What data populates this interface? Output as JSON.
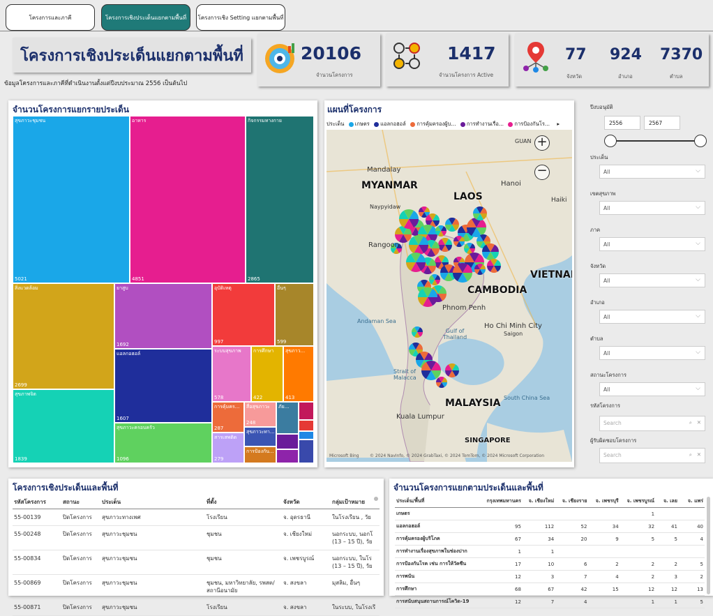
{
  "tabs": [
    {
      "label": "โครงการและภาคี"
    },
    {
      "label": "โครงการเชิงประเด็นแยกตามพื้นที่"
    },
    {
      "label": "โครงการเชิง Setting แยกตามพื้นที่"
    }
  ],
  "header": {
    "title": "โครงการเชิงประเด็นแยกตามพื้นที่",
    "subtitle": "ข้อมูลโครงการและภาคีที่ดำเนินงานตั้งแต่ปีงบประมาณ 2556 เป็นต้นไป"
  },
  "kpi": {
    "projects_value": "20106",
    "projects_label": "จำนวนโครงการ",
    "active_value": "1417",
    "active_label": "จำนวนโครงการ Active",
    "province_value": "77",
    "province_label": "จังหวัด",
    "district_value": "924",
    "district_label": "อำเภอ",
    "subdistrict_value": "7370",
    "subdistrict_label": "ตำบล"
  },
  "treemap": {
    "title": "จำนวนโครงการแยกรายประเด็น",
    "items": [
      {
        "name": "สุขภาวะชุมชน",
        "value": "5021",
        "color": "#1aa7e8"
      },
      {
        "name": "อาหาร",
        "value": "4851",
        "color": "#e61e8f"
      },
      {
        "name": "กิจกรรมทางกาย",
        "value": "2865",
        "color": "#1f7472"
      },
      {
        "name": "สิ่งแวดล้อม",
        "value": "2699",
        "color": "#d2a51a"
      },
      {
        "name": "ยาสูบ",
        "value": "1692",
        "color": "#b14fc1"
      },
      {
        "name": "อุบัติเหตุ",
        "value": "997",
        "color": "#f23b3b"
      },
      {
        "name": "อื่นๆ",
        "value": "599",
        "color": "#a7862a"
      },
      {
        "name": "แอลกอฮอล์",
        "value": "1607",
        "color": "#1f2e9b"
      },
      {
        "name": "ระบบสุขภาพ",
        "value": "578",
        "color": "#e777c9"
      },
      {
        "name": "การศึกษา",
        "value": "422",
        "color": "#e3b400"
      },
      {
        "name": "สุขภาว...",
        "value": "413",
        "color": "#ff7a00"
      },
      {
        "name": "สุขภาพจิต",
        "value": "1839",
        "color": "#15d2b5"
      },
      {
        "name": "สุขภาวะครอบครัว",
        "value": "1096",
        "color": "#5fd15f"
      },
      {
        "name": "การคุ้มคร...",
        "value": "287",
        "color": "#ed6b3a"
      },
      {
        "name": "สื่อสุขภาวะ",
        "value": "248",
        "color": "#f79a9a"
      },
      {
        "name": "สารเสพติด",
        "value": "279",
        "color": "#bda1f7"
      },
      {
        "name": "สุขภาวะทา...",
        "value": "",
        "color": "#3b55b3"
      },
      {
        "name": "การป้องกัน...",
        "value": "",
        "color": "#d47a1f"
      },
      {
        "name": "ภัย...",
        "value": "",
        "color": "#3b7ca0"
      }
    ]
  },
  "map": {
    "title": "แผนที่โครงการ",
    "legend_label": "ประเด็น",
    "legend": [
      {
        "name": "เกษตร",
        "color": "#1aa7e8"
      },
      {
        "name": "แอลกอฮอล์",
        "color": "#1f2e9b"
      },
      {
        "name": "การคุ้มครองผู้บ...",
        "color": "#ed6b3a"
      },
      {
        "name": "การทำงานเรื่อ...",
        "color": "#6a1b9a"
      },
      {
        "name": "การป้องกันโร...",
        "color": "#e61e8f"
      }
    ],
    "labels": [
      "MYANMAR",
      "LAOS",
      "VIETNAM",
      "CAMBODIA",
      "MALAYSIA",
      "SINGAPORE",
      "Mandalay",
      "Naypyidaw",
      "Rangoon",
      "Hanoi",
      "Phnom Penh",
      "Ho Chi Minh City",
      "Saigon",
      "Andaman Sea",
      "Gulf of Thailand",
      "Strait of Malacca",
      "South China Sea",
      "Kuala Lumpur",
      "Haiki",
      "GUAN"
    ],
    "copyright": "© 2024 NavInfo, © 2024 GrabTaxi, © 2024 TomTom, © 2024 Microsoft Corporation",
    "bing": "Microsoft Bing"
  },
  "filters": {
    "year_label": "ปีงบอนุมัติ",
    "year_from": "2556",
    "year_to": "2567",
    "items": [
      {
        "label": "ประเด็น",
        "value": "All"
      },
      {
        "label": "เขตสุขภาพ",
        "value": "All"
      },
      {
        "label": "ภาค",
        "value": "All"
      },
      {
        "label": "จังหวัด",
        "value": "All"
      },
      {
        "label": "อำเภอ",
        "value": "All"
      },
      {
        "label": "ตำบล",
        "value": "All"
      },
      {
        "label": "สถานะโครงการ",
        "value": "All"
      }
    ],
    "code_label": "รหัสโครงการ",
    "code_placeholder": "Search",
    "owner_label": "ผู้รับผิดชอบโครงการ",
    "owner_placeholder": "Search"
  },
  "table1": {
    "title": "โครงการเชิงประเด็นและพื้นที่",
    "headers": [
      "รหัสโครงการ",
      "สถานะ",
      "ประเด็น",
      "ที่ตั้ง",
      "จังหวัด",
      "กลุ่มเป้าหมาย"
    ],
    "rows": [
      [
        "55-00139",
        "ปิดโครงการ",
        "สุขภาวะทางเพศ",
        "โรงเรียน",
        "จ. อุดรธานี",
        "ในโรงเรียน , วัย"
      ],
      [
        "55-00248",
        "ปิดโครงการ",
        "สุขภาวะชุมชน",
        "ชุมชน",
        "จ. เชียงใหม่",
        "นอกระบบ, นอกโ (13 – 15 ปี), วัย"
      ],
      [
        "55-00834",
        "ปิดโครงการ",
        "สุขภาวะชุมชน",
        "ชุมชน",
        "จ. เพชรบูรณ์",
        "นอกระบบ, ในโร (13 – 15 ปี), วัย"
      ],
      [
        "55-00869",
        "ปิดโครงการ",
        "สุขภาวะชุมชน",
        "ชุมชน, มหาวิทยาลัย, รพสต/สถานีอนามัย",
        "จ. สงขลา",
        "มุสลิม, อื่นๆ"
      ],
      [
        "55-00871",
        "ปิดโครงการ",
        "สุขภาวะชุมชน",
        "โรงเรียน",
        "จ. สงขลา",
        "ในระบบ, ในโรงเรี"
      ]
    ]
  },
  "table2": {
    "title": "จำนวนโครงการแยกตามประเด็นและพื้นที่",
    "headers": [
      "ประเด็น/พื้นที่",
      "กรุงเทพมหานคร",
      "จ. เชียงใหม่",
      "จ. เชียงราย",
      "จ. เพชรบุรี",
      "จ. เพชรบูรณ์",
      "จ. เลย",
      "จ. แพร่"
    ],
    "rows": [
      [
        "เกษตร",
        "",
        "",
        "",
        "",
        "1",
        "",
        ""
      ],
      [
        "แอลกอฮอล์",
        "95",
        "112",
        "52",
        "34",
        "32",
        "41",
        "40"
      ],
      [
        "การคุ้มครองผู้บริโภค",
        "67",
        "34",
        "20",
        "9",
        "5",
        "5",
        "4"
      ],
      [
        "การทำงานเรื่องสุขภาพในช่องปาก",
        "1",
        "1",
        "",
        "",
        "",
        "",
        ""
      ],
      [
        "การป้องกันโรค เช่น การให้วัคซีน",
        "17",
        "10",
        "6",
        "2",
        "2",
        "2",
        "5"
      ],
      [
        "การพนัน",
        "12",
        "3",
        "7",
        "4",
        "2",
        "3",
        "2"
      ],
      [
        "การศึกษา",
        "68",
        "67",
        "42",
        "15",
        "12",
        "12",
        "13"
      ],
      [
        "การสนับสนุนสถานการณ์โควิด-19",
        "12",
        "7",
        "4",
        "",
        "1",
        "1",
        "5"
      ]
    ]
  }
}
